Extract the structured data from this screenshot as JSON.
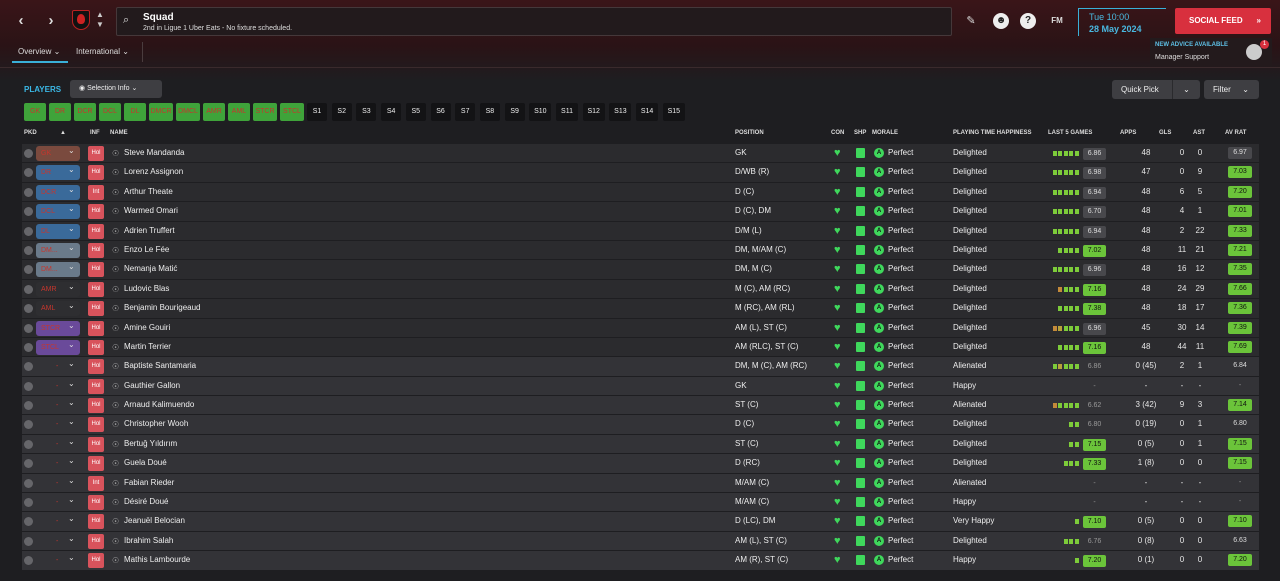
{
  "header": {
    "title": "Squad",
    "subtitle": "2nd in Ligue 1 Uber Eats - No fixture scheduled.",
    "day_time": "Tue 10:00",
    "date": "28 May 2024",
    "social_feed": "SOCIAL FEED",
    "fm": "FM",
    "help": "?",
    "advice_title": "NEW ADVICE AVAILABLE",
    "advice_sub": "Manager Support",
    "advice_badge": "1"
  },
  "tabs": {
    "overview": "Overview",
    "international": "International"
  },
  "toolbar": {
    "players": "PLAYERS",
    "selection_info": "Selection Info",
    "quick_pick": "Quick Pick",
    "filter": "Filter"
  },
  "position_buttons": [
    "GK",
    "DR",
    "DCR",
    "DCL",
    "DL",
    "DMCR",
    "DMCL",
    "AMR",
    "AML",
    "STCR",
    "STCL",
    "S1",
    "S2",
    "S3",
    "S4",
    "S5",
    "S6",
    "S7",
    "S8",
    "S9",
    "S10",
    "S11",
    "S12",
    "S13",
    "S14",
    "S15"
  ],
  "columns": {
    "pkd": "PKD",
    "inf": "INF",
    "name": "NAME",
    "position": "POSITION",
    "con": "CON",
    "shp": "SHP",
    "morale": "MORALE",
    "pth": "PLAYING TIME HAPPINESS",
    "last5": "LAST 5 GAMES",
    "apps": "APPS",
    "gls": "GLS",
    "ast": "AST",
    "avrat": "AV RAT"
  },
  "players": [
    {
      "pkd": "GK",
      "pkd_color": "#7a4a3e",
      "inf": "Hol",
      "name": "Steve Mandanda",
      "position": "GK",
      "morale": "Perfect",
      "happiness": "Delighted",
      "last5": "6.86",
      "l5g": "g",
      "apps": "48",
      "gls": "0",
      "ast": "0",
      "avrat": "6.97",
      "avc": "grey"
    },
    {
      "pkd": "DR",
      "pkd_color": "#3a6a9a",
      "inf": "Hol",
      "name": "Lorenz Assignon",
      "position": "D/WB (R)",
      "morale": "Perfect",
      "happiness": "Delighted",
      "last5": "6.98",
      "l5g": "g",
      "apps": "47",
      "gls": "0",
      "ast": "9",
      "avrat": "7.03",
      "avc": "green"
    },
    {
      "pkd": "DCR",
      "pkd_color": "#3a6a9a",
      "inf": "Int",
      "name": "Arthur Theate",
      "position": "D (C)",
      "morale": "Perfect",
      "happiness": "Delighted",
      "last5": "6.94",
      "l5g": "g",
      "apps": "48",
      "gls": "6",
      "ast": "5",
      "avrat": "7.20",
      "avc": "green"
    },
    {
      "pkd": "DCL",
      "pkd_color": "#3a6a9a",
      "inf": "Hol",
      "name": "Warmed Omari",
      "position": "D (C), DM",
      "morale": "Perfect",
      "happiness": "Delighted",
      "last5": "6.70",
      "l5g": "g",
      "apps": "48",
      "gls": "4",
      "ast": "1",
      "avrat": "7.01",
      "avc": "green"
    },
    {
      "pkd": "DL",
      "pkd_color": "#3a6a9a",
      "inf": "Hol",
      "name": "Adrien Truffert",
      "position": "D/M (L)",
      "morale": "Perfect",
      "happiness": "Delighted",
      "last5": "6.94",
      "l5g": "g",
      "apps": "48",
      "gls": "2",
      "ast": "22",
      "avrat": "7.33",
      "avc": "green"
    },
    {
      "pkd": "DM...",
      "pkd_color": "#6a7a8a",
      "inf": "Hol",
      "name": "Enzo Le Fée",
      "position": "DM, M/AM (C)",
      "morale": "Perfect",
      "happiness": "Delighted",
      "last5": "7.02",
      "l5g": "G",
      "apps": "48",
      "gls": "11",
      "ast": "21",
      "avrat": "7.21",
      "avc": "green"
    },
    {
      "pkd": "DM...",
      "pkd_color": "#6a7a8a",
      "inf": "Hol",
      "name": "Nemanja Matić",
      "position": "DM, M (C)",
      "morale": "Perfect",
      "happiness": "Delighted",
      "last5": "6.96",
      "l5g": "g",
      "apps": "48",
      "gls": "16",
      "ast": "12",
      "avrat": "7.35",
      "avc": "green"
    },
    {
      "pkd": "AMR",
      "pkd_color": "#2e2e31",
      "inf": "Hol",
      "name": "Ludovic Blas",
      "position": "M (C), AM (RC)",
      "morale": "Perfect",
      "happiness": "Delighted",
      "last5": "7.16",
      "l5g": "G",
      "apps": "48",
      "gls": "24",
      "ast": "29",
      "avrat": "7.66",
      "avc": "green"
    },
    {
      "pkd": "AML",
      "pkd_color": "#2e2e31",
      "inf": "Hol",
      "name": "Benjamin Bourigeaud",
      "position": "M (RC), AM (RL)",
      "morale": "Perfect",
      "happiness": "Delighted",
      "last5": "7.38",
      "l5g": "G",
      "apps": "48",
      "gls": "18",
      "ast": "17",
      "avrat": "7.36",
      "avc": "green"
    },
    {
      "pkd": "STCR",
      "pkd_color": "#6a4a9a",
      "inf": "Hol",
      "name": "Amine Gouiri",
      "position": "AM (L), ST (C)",
      "morale": "Perfect",
      "happiness": "Delighted",
      "last5": "6.96",
      "l5g": "g",
      "apps": "45",
      "gls": "30",
      "ast": "14",
      "avrat": "7.39",
      "avc": "green"
    },
    {
      "pkd": "STCL",
      "pkd_color": "#6a4a9a",
      "inf": "Hol",
      "name": "Martin Terrier",
      "position": "AM (RLC), ST (C)",
      "morale": "Perfect",
      "happiness": "Delighted",
      "last5": "7.16",
      "l5g": "G",
      "apps": "48",
      "gls": "44",
      "ast": "11",
      "avrat": "7.69",
      "avc": "green"
    },
    {
      "pkd": "-",
      "pkd_color": "",
      "inf": "Hol",
      "name": "Baptiste Santamaria",
      "position": "DM, M (C), AM (RC)",
      "morale": "Perfect",
      "happiness": "Alienated",
      "last5": "6.86",
      "l5g": "n",
      "apps": "0 (45)",
      "gls": "2",
      "ast": "1",
      "avrat": "6.84",
      "avc": "plain"
    },
    {
      "pkd": "-",
      "pkd_color": "",
      "inf": "Hol",
      "name": "Gauthier Gallon",
      "position": "GK",
      "morale": "Perfect",
      "happiness": "Happy",
      "last5": "-",
      "l5g": "x",
      "apps": "-",
      "gls": "-",
      "ast": "-",
      "avrat": "-",
      "avc": "none"
    },
    {
      "pkd": "-",
      "pkd_color": "",
      "inf": "Hol",
      "name": "Arnaud Kalimuendo",
      "position": "ST (C)",
      "morale": "Perfect",
      "happiness": "Alienated",
      "last5": "6.62",
      "l5g": "n",
      "apps": "3 (42)",
      "gls": "9",
      "ast": "3",
      "avrat": "7.14",
      "avc": "green"
    },
    {
      "pkd": "-",
      "pkd_color": "",
      "inf": "Hol",
      "name": "Christopher Wooh",
      "position": "D (C)",
      "morale": "Perfect",
      "happiness": "Delighted",
      "last5": "6.80",
      "l5g": "n",
      "apps": "0 (19)",
      "gls": "0",
      "ast": "1",
      "avrat": "6.80",
      "avc": "plain"
    },
    {
      "pkd": "-",
      "pkd_color": "",
      "inf": "Hol",
      "name": "Bertuğ Yıldırım",
      "position": "ST (C)",
      "morale": "Perfect",
      "happiness": "Delighted",
      "last5": "7.15",
      "l5g": "G",
      "apps": "0 (5)",
      "gls": "0",
      "ast": "1",
      "avrat": "7.15",
      "avc": "green"
    },
    {
      "pkd": "-",
      "pkd_color": "",
      "inf": "Hol",
      "name": "Guela Doué",
      "position": "D (RC)",
      "morale": "Perfect",
      "happiness": "Delighted",
      "last5": "7.33",
      "l5g": "G",
      "apps": "1 (8)",
      "gls": "0",
      "ast": "0",
      "avrat": "7.15",
      "avc": "green"
    },
    {
      "pkd": "-",
      "pkd_color": "",
      "inf": "Int",
      "name": "Fabian Rieder",
      "position": "M/AM (C)",
      "morale": "Perfect",
      "happiness": "Alienated",
      "last5": "-",
      "l5g": "x",
      "apps": "-",
      "gls": "-",
      "ast": "-",
      "avrat": "-",
      "avc": "none"
    },
    {
      "pkd": "-",
      "pkd_color": "",
      "inf": "Hol",
      "name": "Désiré Doué",
      "position": "M/AM (C)",
      "morale": "Perfect",
      "happiness": "Happy",
      "last5": "-",
      "l5g": "x",
      "apps": "-",
      "gls": "-",
      "ast": "-",
      "avrat": "-",
      "avc": "none"
    },
    {
      "pkd": "-",
      "pkd_color": "",
      "inf": "Hol",
      "name": "Jeanuël Belocian",
      "position": "D (LC), DM",
      "morale": "Perfect",
      "happiness": "Very Happy",
      "last5": "7.10",
      "l5g": "G",
      "apps": "0 (5)",
      "gls": "0",
      "ast": "0",
      "avrat": "7.10",
      "avc": "green"
    },
    {
      "pkd": "-",
      "pkd_color": "",
      "inf": "Hol",
      "name": "Ibrahim Salah",
      "position": "AM (L), ST (C)",
      "morale": "Perfect",
      "happiness": "Delighted",
      "last5": "6.76",
      "l5g": "n",
      "apps": "0 (8)",
      "gls": "0",
      "ast": "0",
      "avrat": "6.63",
      "avc": "plain"
    },
    {
      "pkd": "-",
      "pkd_color": "",
      "inf": "Hol",
      "name": "Mathis Lambourde",
      "position": "AM (R), ST (C)",
      "morale": "Perfect",
      "happiness": "Happy",
      "last5": "7.20",
      "l5g": "G",
      "apps": "0 (1)",
      "gls": "0",
      "ast": "0",
      "avrat": "7.20",
      "avc": "green"
    }
  ]
}
